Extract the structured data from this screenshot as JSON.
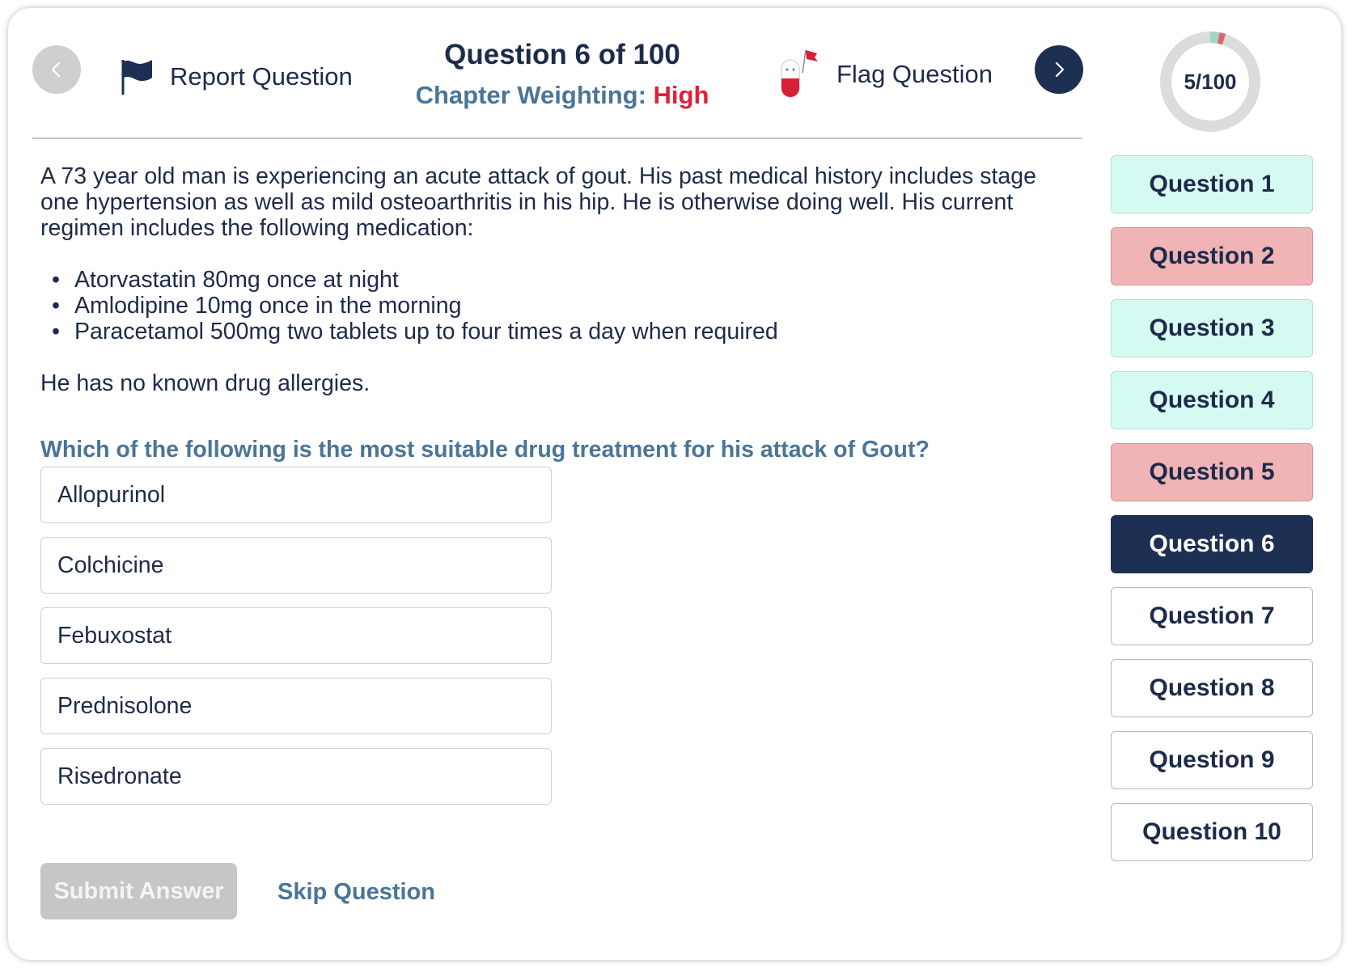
{
  "header": {
    "title": "Question 6 of 100",
    "weighting_label": "Chapter Weighting:",
    "weighting_value": "High",
    "report_label": "Report Question",
    "flag_label": "Flag Question"
  },
  "progress": {
    "label": "5/100",
    "answered": 5,
    "total": 100,
    "colors": {
      "correct": "#9fd6c9",
      "wrong": "#e0646a",
      "track": "#dcdcdc"
    }
  },
  "question": {
    "intro": "A 73 year old man is experiencing an acute attack of gout. His past medical history includes stage one hypertension as well as mild osteoarthritis in his hip. He is otherwise doing well.  His current regimen includes the following medication:",
    "medications": [
      "Atorvastatin 80mg once at night",
      "Amlodipine 10mg once in the morning",
      "Paracetamol 500mg two tablets up to four times a day when required"
    ],
    "allergies": "He has no known drug allergies.",
    "prompt": "Which of the following is the most suitable drug treatment for his attack of Gout?"
  },
  "options": [
    "Allopurinol",
    "Colchicine",
    "Febuxostat",
    "Prednisolone",
    "Risedronate"
  ],
  "actions": {
    "submit": "Submit Answer",
    "skip": "Skip Question"
  },
  "sidebar": {
    "items": [
      {
        "label": "Question 1",
        "status": "correct"
      },
      {
        "label": "Question 2",
        "status": "wrong"
      },
      {
        "label": "Question 3",
        "status": "correct"
      },
      {
        "label": "Question 4",
        "status": "correct"
      },
      {
        "label": "Question 5",
        "status": "wrong"
      },
      {
        "label": "Question 6",
        "status": "current"
      },
      {
        "label": "Question 7",
        "status": "todo"
      },
      {
        "label": "Question 8",
        "status": "todo"
      },
      {
        "label": "Question 9",
        "status": "todo"
      },
      {
        "label": "Question 10",
        "status": "todo"
      }
    ]
  },
  "icons": {
    "prev": "chevron-left-icon",
    "next": "chevron-right-icon",
    "report": "flag-icon",
    "flag": "pill-flag-icon"
  }
}
